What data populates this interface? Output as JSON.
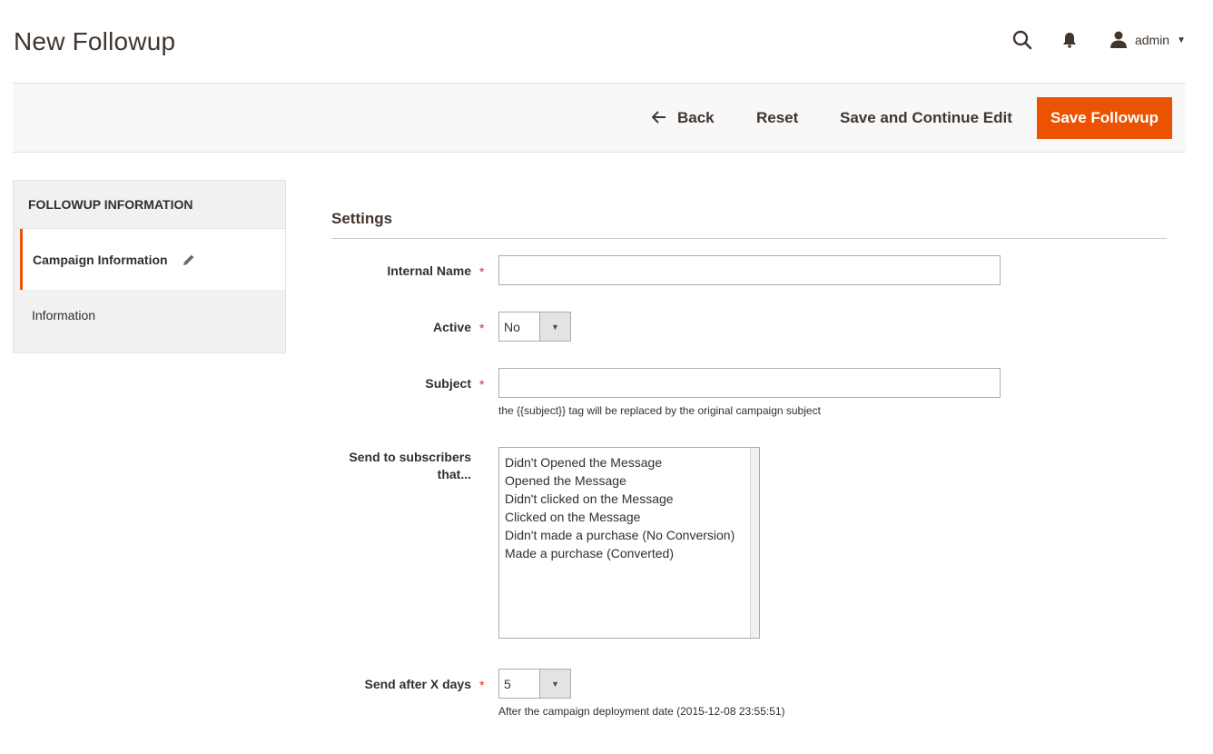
{
  "page": {
    "title": "New Followup"
  },
  "header": {
    "user_name": "admin",
    "icons": {
      "search": "search-icon",
      "notifications": "bell-icon",
      "user": "user-icon"
    }
  },
  "actions": {
    "back": "Back",
    "reset": "Reset",
    "save_continue": "Save and Continue Edit",
    "save": "Save Followup",
    "accent_color": "#eb5202"
  },
  "sidebar": {
    "title": "FOLLOWUP INFORMATION",
    "items": [
      {
        "label": "Campaign Information",
        "active": true
      },
      {
        "label": "Information",
        "active": false
      }
    ]
  },
  "form": {
    "section_title": "Settings",
    "internal_name": {
      "label": "Internal Name",
      "value": "",
      "required": "*"
    },
    "active": {
      "label": "Active",
      "value": "No",
      "required": "*"
    },
    "subject": {
      "label": "Subject",
      "value": "",
      "required": "*",
      "note": "the {{subject}} tag will be replaced by the original campaign subject"
    },
    "send_to": {
      "label_line1": "Send to subscribers",
      "label_line2": "that...",
      "options": [
        "Didn't Opened the Message",
        "Opened the Message",
        "Didn't clicked on the Message",
        "Clicked on the Message",
        "Didn't made a purchase (No Conversion)",
        "Made a purchase (Converted)"
      ]
    },
    "send_after": {
      "label": "Send after X days",
      "value": "5",
      "required": "*",
      "note": "After the campaign deployment date (2015-12-08 23:55:51)"
    }
  }
}
